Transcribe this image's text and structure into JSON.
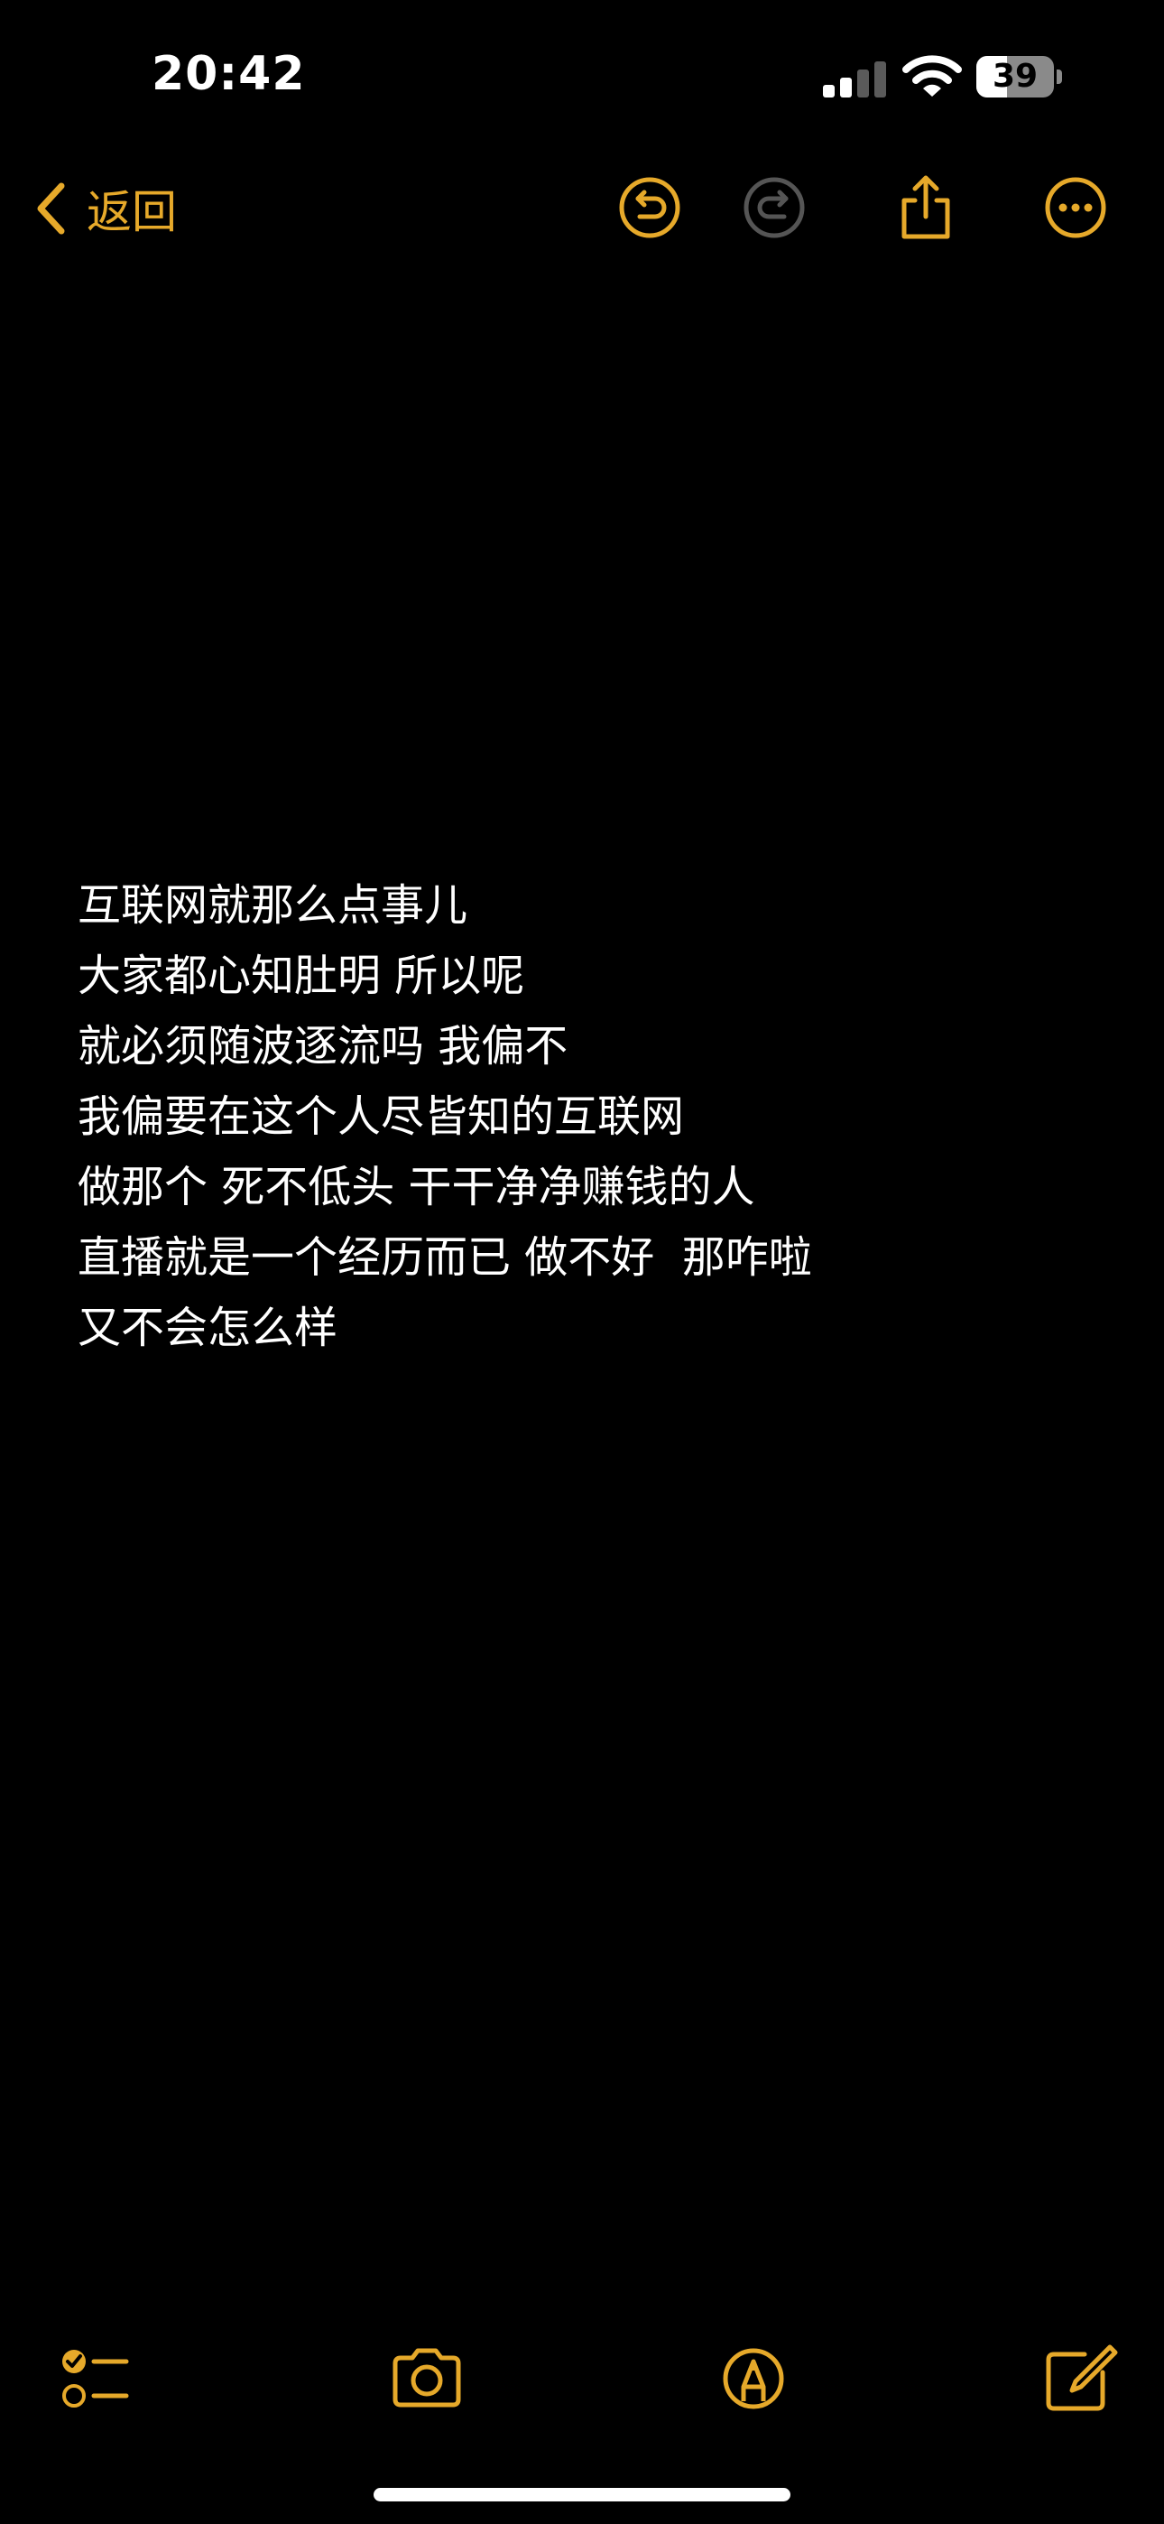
{
  "status_bar": {
    "time": "20:42",
    "battery_level": "39",
    "battery_fraction": 0.39,
    "signal_bars_active": 2,
    "icons": [
      "signal-icon",
      "wifi-icon",
      "battery-icon"
    ]
  },
  "nav": {
    "back_label": "返回",
    "icons": [
      "chevron-left-icon",
      "undo-icon",
      "redo-icon",
      "share-icon",
      "more-icon"
    ]
  },
  "note": {
    "lines": [
      "互联网就那么点事儿",
      "大家都心知肚明 所以呢",
      "就必须随波逐流吗 我偏不",
      "我偏要在这个人尽皆知的互联网",
      "做那个 死不低头 干干净净赚钱的人",
      "直播就是一个经历而已 做不好  那咋啦",
      "又不会怎么样"
    ]
  },
  "toolbar": {
    "icons": [
      "checklist-icon",
      "camera-icon",
      "markup-icon",
      "compose-icon"
    ]
  },
  "colors": {
    "background": "#000000",
    "text": "#ffffff",
    "accent": "#e6a92a",
    "disabled": "#555555"
  }
}
